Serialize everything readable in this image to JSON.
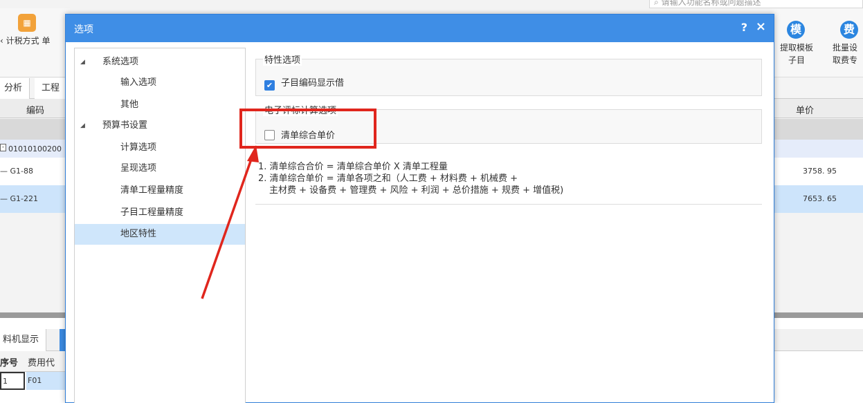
{
  "bg": {
    "search_placeholder": "请输入功能名称或问题描述",
    "toolbar": {
      "tax_mode": "计税方式",
      "tax_trail": "单",
      "extract_template_line1": "提取模板",
      "extract_template_line2": "子目",
      "batch_set_line1": "批量设",
      "batch_set_line2": "取费专",
      "template_icon": "模",
      "fee_icon": "费",
      "left_cut": "‹"
    },
    "tabs": {
      "analysis": "分析",
      "project": "工程"
    },
    "table": {
      "col_code": "编码",
      "col_unit_price": "单价",
      "row1_code": "01010100200",
      "row2_code": "G1-88",
      "row2_price": "3758. 95",
      "row3_code": "G1-221",
      "row3_price": "7653. 65"
    },
    "bottom": {
      "tab_machine": "料机显示",
      "col_no": "序号",
      "col_fee_code": "费用代",
      "row_no": "1",
      "row_code": "F01"
    }
  },
  "dialog": {
    "title": "选项",
    "help": "?",
    "close": "×",
    "tree": {
      "system_options": "系统选项",
      "input_options": "输入选项",
      "other": "其他",
      "budget_settings": "预算书设置",
      "calc_options": "计算选项",
      "display_options": "呈现选项",
      "bill_qty_precision": "清单工程量精度",
      "sub_qty_precision": "子目工程量精度",
      "regional_features": "地区特性"
    },
    "feature_group": {
      "title": "特性选项",
      "checkbox_label": "子目编码显示借",
      "checked": true
    },
    "ebid_group": {
      "title": "电子评标计算选项",
      "checkbox_label": "清单综合单价",
      "checked": false
    },
    "notes": {
      "line1": "1. 清单综合合价 = 清单综合单价 X 清单工程量",
      "line2": "2. 清单综合单价 = 清单各项之和（人工费 + 材料费 + 机械费 +",
      "line3": "主材费 + 设备费 + 管理费 + 风险 + 利润 + 总价措施 + 规费 + 增值税)"
    }
  },
  "colors": {
    "title_bar": "#3f8ee6",
    "highlight": "#e0261d",
    "selected_tree": "#cfe6fb",
    "checkbox_on": "#2f7fe0"
  }
}
